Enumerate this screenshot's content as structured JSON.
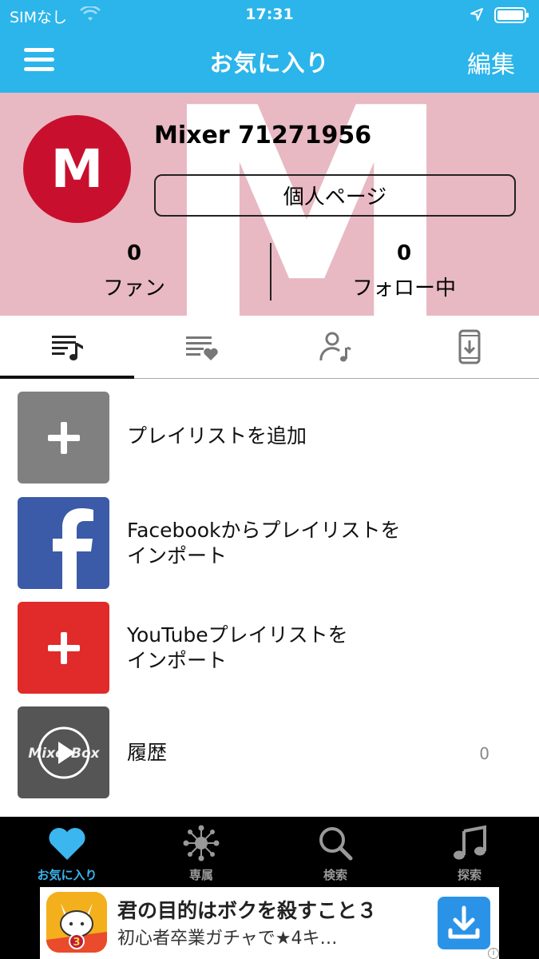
{
  "status": {
    "carrier": "SIMなし",
    "time": "17:31"
  },
  "nav": {
    "title": "お気に入り",
    "edit": "編集"
  },
  "profile": {
    "avatar_letter": "M",
    "bg_letter": "M",
    "username": "Mixer 71271956",
    "page_button": "個人ページ",
    "fans_count": "0",
    "fans_label": "ファン",
    "following_count": "0",
    "following_label": "フォロー中"
  },
  "tabs": [
    {
      "icon": "playlist-music-icon"
    },
    {
      "icon": "favorite-list-icon"
    },
    {
      "icon": "artist-icon"
    },
    {
      "icon": "phone-download-icon"
    }
  ],
  "list": [
    {
      "label": "プレイリストを追加",
      "icon": "plus-icon",
      "color": "#808080"
    },
    {
      "label": "Facebookからプレイリストを\nインポート",
      "icon": "facebook-icon",
      "color": "#3b5ba8"
    },
    {
      "label": "YouTubeプレイリストを\nインポート",
      "icon": "plus-icon",
      "color": "#e12a2a"
    },
    {
      "label": "履歴",
      "icon": "mixerbox-icon",
      "color": "#555555",
      "count": "0",
      "thumb_text": "MixerBox"
    }
  ],
  "tabbar": [
    {
      "label": "お気に入り",
      "icon": "heart-icon",
      "active": true
    },
    {
      "label": "専属",
      "icon": "network-icon"
    },
    {
      "label": "検索",
      "icon": "search-icon"
    },
    {
      "label": "探索",
      "icon": "music-note-icon"
    }
  ],
  "ad": {
    "title": "君の目的はボクを殺すこと３",
    "subtitle": "初心者卒業ガチャで★4キ…",
    "info": "i"
  },
  "colors": {
    "accent": "#2bb5ea",
    "profile_bg": "#e8b9c3",
    "avatar": "#c8102e",
    "active_tab": "#3bb6ee"
  }
}
